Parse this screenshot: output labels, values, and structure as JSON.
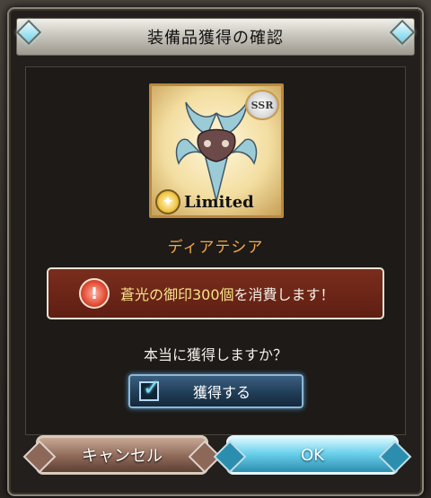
{
  "dialog": {
    "title": "装備品獲得の確認",
    "item": {
      "name": "ディアテシア",
      "rarity": "SSR",
      "tag": "Limited",
      "icon": "weapon-crest-icon"
    },
    "warning": {
      "highlight": "蒼光の御印300個",
      "suffix": "を消費します！"
    },
    "question": "本当に獲得しますか？",
    "confirm_checkbox": {
      "label": "獲得する",
      "checked": true
    },
    "buttons": {
      "cancel": "キャンセル",
      "ok": "OK"
    }
  },
  "colors": {
    "item_name": "#f6a94b",
    "warning_bg": "#6b2617",
    "warning_highlight": "#f9e38b",
    "ok_button": "#6bd1ec",
    "cancel_button": "#8d6858"
  }
}
